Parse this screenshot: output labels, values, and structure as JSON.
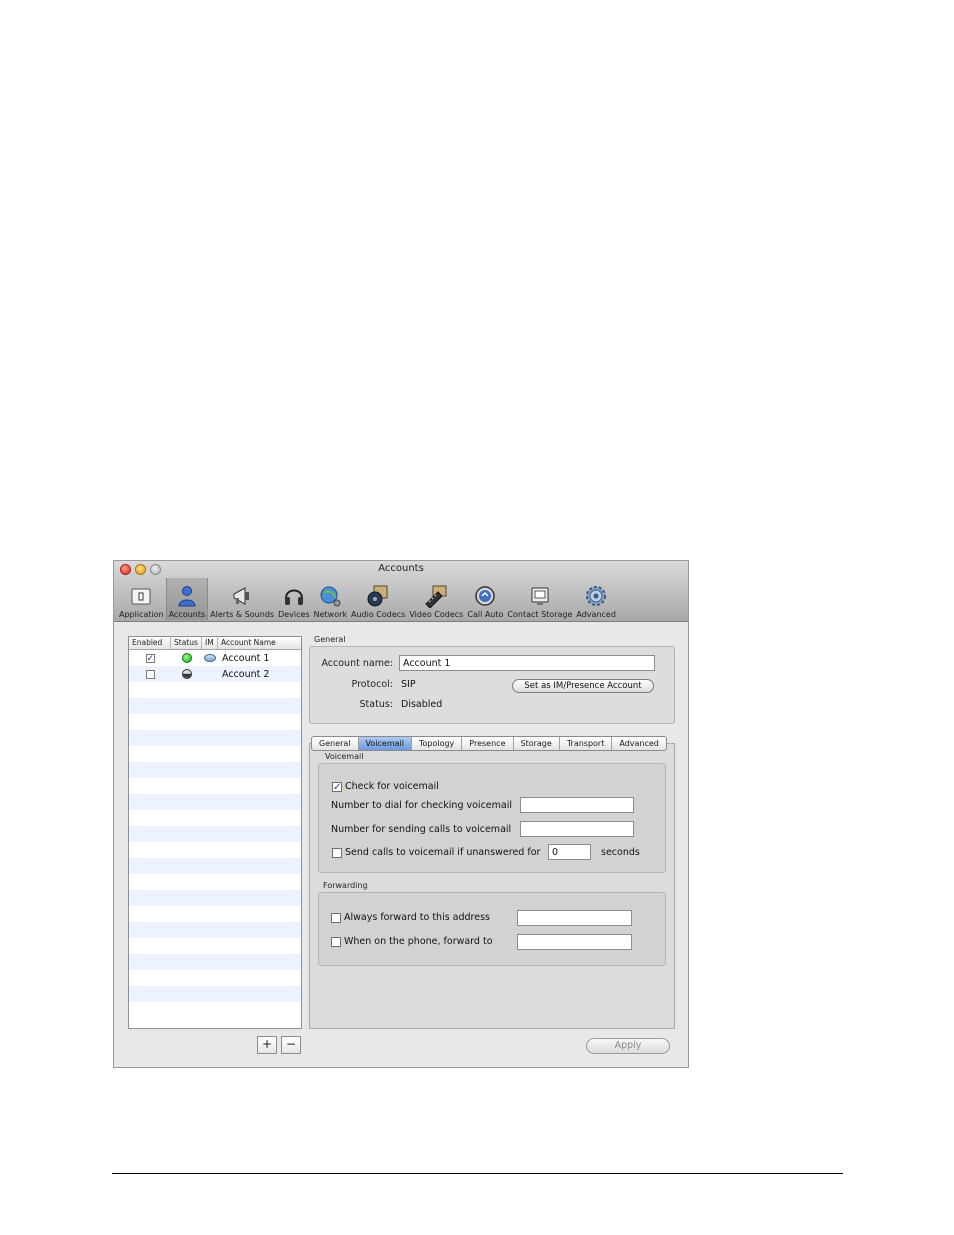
{
  "window": {
    "title": "Accounts"
  },
  "toolbar": {
    "items": [
      {
        "label": "Application",
        "icon": "application-icon"
      },
      {
        "label": "Accounts",
        "icon": "accounts-icon",
        "selected": true
      },
      {
        "label": "Alerts & Sounds",
        "icon": "megaphone-icon"
      },
      {
        "label": "Devices",
        "icon": "headset-icon"
      },
      {
        "label": "Network",
        "icon": "network-globe-icon"
      },
      {
        "label": "Audio Codecs",
        "icon": "audio-codecs-icon"
      },
      {
        "label": "Video Codecs",
        "icon": "film-icon"
      },
      {
        "label": "Call Auto",
        "icon": "call-auto-icon"
      },
      {
        "label": "Contact Storage",
        "icon": "contact-storage-icon"
      },
      {
        "label": "Advanced",
        "icon": "gear-icon"
      }
    ]
  },
  "accounts_table": {
    "columns": [
      "Enabled",
      "Status",
      "IM",
      "Account Name"
    ],
    "rows": [
      {
        "enabled": true,
        "status": "online",
        "im": true,
        "name": "Account 1"
      },
      {
        "enabled": false,
        "status": "offline",
        "im": false,
        "name": "Account 2"
      }
    ],
    "add_label": "+",
    "remove_label": "−"
  },
  "general": {
    "group_label": "General",
    "account_name_label": "Account name:",
    "account_name_value": "Account 1",
    "protocol_label": "Protocol:",
    "protocol_value": "SIP",
    "status_label": "Status:",
    "status_value": "Disabled",
    "set_im_button": "Set as IM/Presence Account"
  },
  "tabs": {
    "items": [
      "General",
      "Voicemail",
      "Topology",
      "Presence",
      "Storage",
      "Transport",
      "Advanced"
    ],
    "active": "Voicemail"
  },
  "voicemail": {
    "group_label": "Voicemail",
    "check_label": "Check for voicemail",
    "check_value": true,
    "dial_number_label": "Number to dial for checking voicemail",
    "dial_number_value": "",
    "send_number_label": "Number for sending calls to voicemail",
    "send_number_value": "",
    "unanswered_label": "Send calls to voicemail if unanswered for",
    "unanswered_checked": false,
    "unanswered_value": "0",
    "seconds_label": "seconds"
  },
  "forwarding": {
    "group_label": "Forwarding",
    "always_label": "Always forward to this address",
    "always_checked": false,
    "always_value": "",
    "on_phone_label": "When on the phone, forward to",
    "on_phone_checked": false,
    "on_phone_value": ""
  },
  "footer": {
    "apply_label": "Apply"
  },
  "colors": {
    "status_online": "#14a414",
    "active_tab": "#6b9ae0",
    "check_mark": "#1c3e9c"
  }
}
